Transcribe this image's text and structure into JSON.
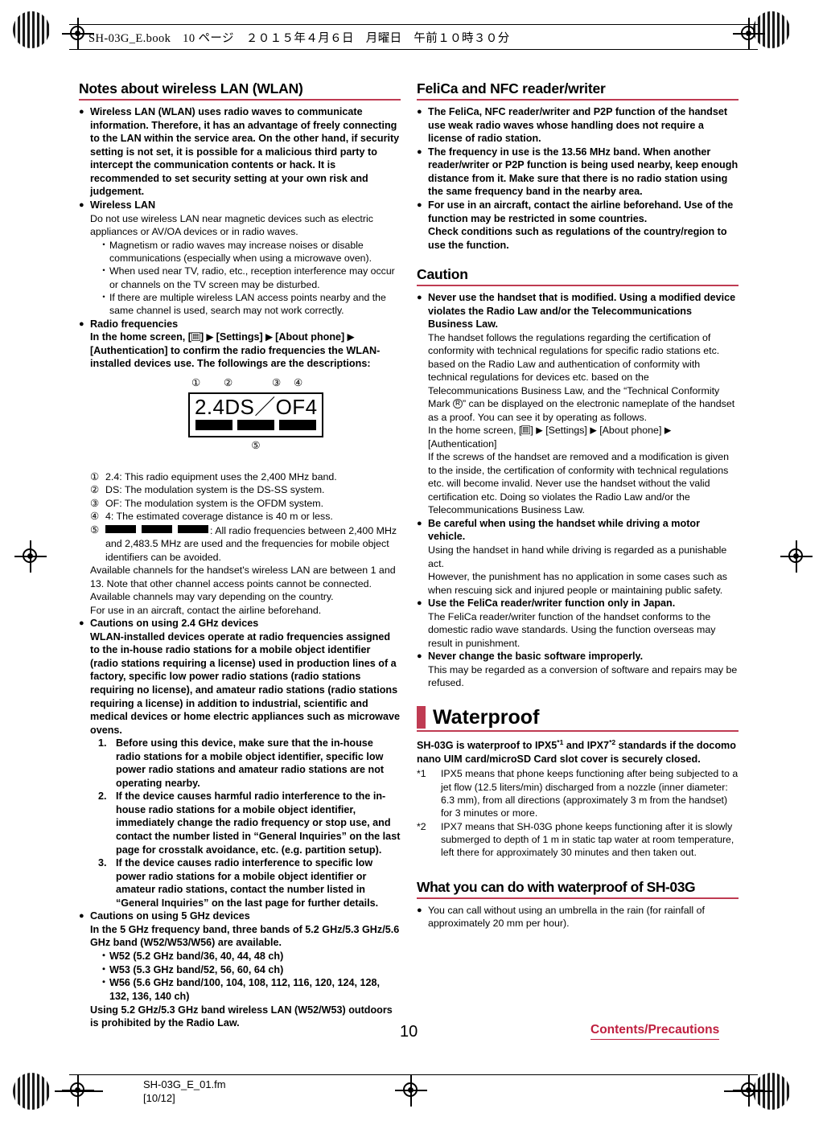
{
  "slug": {
    "header": "SH-03G_E.book　10 ページ　２０１５年４月６日　月曜日　午前１０時３０分",
    "file_name": "SH-03G_E_01.fm",
    "file_pages": "[10/12]"
  },
  "footer": {
    "page_number": "10",
    "running_head": "Contents/Precautions"
  },
  "colors": {
    "accent_red": "#bf3b52",
    "running_head_red": "#bf1f3f"
  },
  "left_column": {
    "heading": "Notes about wireless LAN (WLAN)",
    "intro_bullet": "Wireless LAN (WLAN) uses radio waves to communicate information. Therefore, it has an advantage of freely connecting to the LAN within the service area. On the other hand, if security setting is not set, it is possible for a malicious third party to intercept the communication contents or hack. It is recommended to set security setting at your own risk and judgement.",
    "wireless_lan": {
      "title": "Wireless LAN",
      "body": "Do not use wireless LAN near magnetic devices such as electric appliances or AV/OA devices or in radio waves.",
      "items": [
        "Magnetism or radio waves may increase noises or disable communications (especially when using a microwave oven).",
        "When used near TV, radio, etc., reception interference may occur or channels on the TV screen may be disturbed.",
        "If there are multiple wireless LAN access points nearby and the same channel is used, search may not work correctly."
      ]
    },
    "radio_frequencies": {
      "title": "Radio frequencies",
      "path_prefix": "In the home screen, [",
      "path_step1": "] ",
      "path_step2": " [Settings] ",
      "path_step3": " [About phone] ",
      "path_step4": " [Authentication] to confirm the radio frequencies the WLAN-installed devices use. The followings are the descriptions:",
      "diagram": {
        "label_1": "①",
        "label_2": "②",
        "label_3": "③",
        "label_4": "④",
        "label_5": "⑤",
        "text": "2.4DS／OF4"
      },
      "legend": [
        {
          "mark": "①",
          "text": "2.4: This radio equipment uses the 2,400 MHz band."
        },
        {
          "mark": "②",
          "text": "DS: The modulation system is the DS-SS system."
        },
        {
          "mark": "③",
          "text": "OF: The modulation system is the OFDM system."
        },
        {
          "mark": "④",
          "text": "4: The estimated coverage distance is 40 m or less."
        }
      ],
      "legend_5_mark": "⑤",
      "legend_5_text": ": All radio frequencies between 2,400 MHz and 2,483.5 MHz are used and the frequencies for mobile object identifiers can be avoided.",
      "notes": [
        "Available channels for the handset's wireless LAN are between 1 and 13. Note that other channel access points cannot be connected.",
        "Available channels may vary depending on the country.",
        "For use in an aircraft, contact the airline beforehand."
      ]
    },
    "cautions_24": {
      "title": "Cautions on using 2.4 GHz devices",
      "body": "WLAN-installed devices operate at radio frequencies assigned to the in-house radio stations for a mobile object identifier (radio stations requiring a license) used in production lines of a factory, specific low power radio stations (radio stations requiring no license), and amateur radio stations (radio stations requiring a license) in addition to industrial, scientific and medical devices or home electric appliances such as microwave ovens.",
      "steps": [
        {
          "num": "1.",
          "text": "Before using this device, make sure that the in-house radio stations for a mobile object identifier, specific low power radio stations and amateur radio stations are not operating nearby."
        },
        {
          "num": "2.",
          "text": "If the device causes harmful radio interference to the in-house radio stations for a mobile object identifier, immediately change the radio frequency or stop use, and contact the number listed in “General Inquiries” on the last page for crosstalk avoidance, etc. (e.g. partition setup)."
        },
        {
          "num": "3.",
          "text": "If the device causes radio interference to specific low power radio stations for a mobile object identifier or amateur radio stations, contact the number listed in “General Inquiries” on the last page for further details."
        }
      ]
    },
    "cautions_5": {
      "title": "Cautions on using 5 GHz devices",
      "body": "In the 5 GHz frequency band, three bands of 5.2 GHz/5.3 GHz/5.6 GHz band (W52/W53/W56) are available.",
      "bands": [
        "W52 (5.2 GHz band/36, 40, 44, 48 ch)",
        "W53 (5.3 GHz band/52, 56, 60, 64 ch)",
        "W56 (5.6 GHz band/100, 104, 108, 112, 116, 120, 124, 128, 132, 136, 140 ch)"
      ],
      "closing": "Using 5.2 GHz/5.3 GHz band wireless LAN (W52/W53) outdoors is prohibited by the Radio Law."
    }
  },
  "right_column": {
    "felica": {
      "heading": "FeliCa and NFC reader/writer",
      "bullets": [
        "The FeliCa, NFC reader/writer and P2P function of the handset use weak radio waves whose handling does not require a license of radio station.",
        "The frequency in use is the 13.56 MHz band. When another reader/writer or P2P function is being used nearby, keep enough distance from it. Make sure that there is no radio station using the same frequency band in the nearby area.",
        "For use in an aircraft, contact the airline beforehand. Use of the function may be restricted in some countries.\nCheck conditions such as regulations of the country/region to use the function."
      ]
    },
    "caution": {
      "heading": "Caution",
      "item1_title": "Never use the handset that is modified. Using a modified device violates the Radio Law and/or the Telecommunications Business Law.",
      "item1_body_a": "The handset follows the regulations regarding the certification of conformity with technical regulations for specific radio stations etc. based on the Radio Law and authentication of conformity with technical regulations for devices etc. based on the Telecommunications Business Law, and the “Technical Conformity Mark ",
      "item1_body_b": "” can be displayed on the electronic nameplate of the handset as a proof. You can see it by operating as follows.",
      "item1_path_prefix": "In the home screen, [",
      "item1_path_a": "] ",
      "item1_path_b": " [Settings] ",
      "item1_path_c": " [About phone] ",
      "item1_path_d": " [Authentication]",
      "item1_body_c": "If the screws of the handset are removed and a modification is given to the inside, the certification of conformity with technical regulations etc. will become invalid. Never use the handset without the valid certification etc. Doing so violates the Radio Law and/or the Telecommunications Business Law.",
      "item2_title": "Be careful when using the handset while driving a motor vehicle.",
      "item2_body": "Using the handset in hand while driving is regarded as a punishable act.\nHowever, the punishment has no application in some cases such as when rescuing sick and injured people or maintaining public safety.",
      "item3_title": "Use the FeliCa reader/writer function only in Japan.",
      "item3_body": "The FeliCa reader/writer function of the handset conforms to the domestic radio wave standards. Using the function overseas may result in punishment.",
      "item4_title": "Never change the basic software improperly.",
      "item4_body": "This may be regarded as a conversion of software and repairs may be refused."
    },
    "waterproof": {
      "chapter_title": "Waterproof",
      "intro_a": "SH-03G is waterproof to IPX5",
      "intro_sup1": "*1",
      "intro_b": " and IPX7",
      "intro_sup2": "*2",
      "intro_c": " standards if the docomo nano UIM card/microSD Card slot cover is securely closed.",
      "footnotes": [
        {
          "mark": "*1",
          "text": "IPX5 means that phone keeps functioning after being subjected to a jet flow (12.5 liters/min) discharged from a nozzle (inner diameter: 6.3 mm), from all directions (approximately 3 m from the handset) for 3 minutes or more."
        },
        {
          "mark": "*2",
          "text": "IPX7 means that SH-03G phone keeps functioning after it is slowly submerged to depth of 1 m in static tap water at room temperature, left there for approximately 30 minutes and then taken out."
        }
      ],
      "subheading": "What you can do with waterproof of SH-03G",
      "bullet": "You can call without using an umbrella in the rain (for rainfall of approximately 20 mm per hour)."
    }
  }
}
